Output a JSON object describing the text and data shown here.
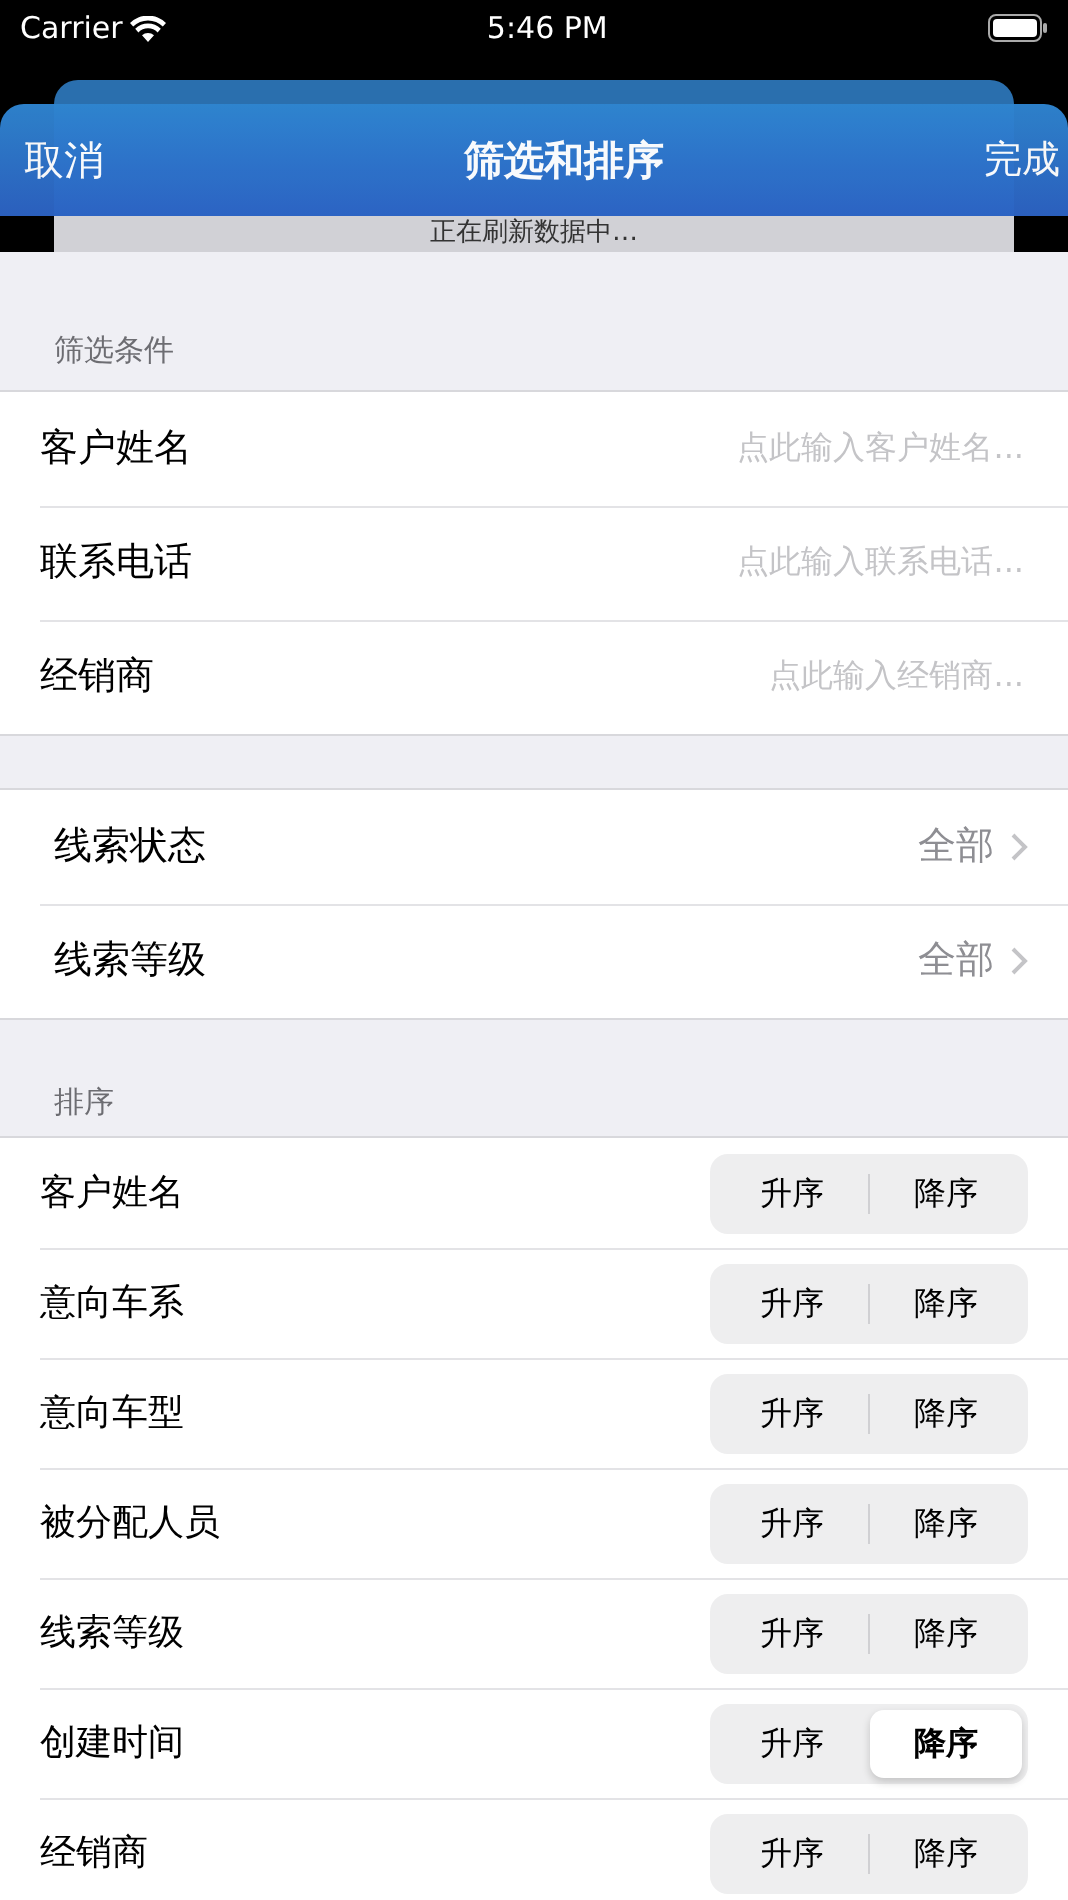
{
  "status_bar": {
    "carrier": "Carrier",
    "time": "5:46 PM"
  },
  "back_sheet": {
    "notice": "正在刷新数据中…"
  },
  "nav_bar": {
    "left": "取消",
    "title": "筛选和排序",
    "right": "完成"
  },
  "filter_section": {
    "header": "筛选条件",
    "fields": [
      {
        "label": "客户姓名",
        "placeholder": "点此输入客户姓名..."
      },
      {
        "label": "联系电话",
        "placeholder": "点此输入联系电话..."
      },
      {
        "label": "经销商",
        "placeholder": "点此输入经销商..."
      }
    ]
  },
  "pickers": [
    {
      "label": "线索状态",
      "value": "全部"
    },
    {
      "label": "线索等级",
      "value": "全部"
    }
  ],
  "sort_section": {
    "header": "排序",
    "rows": [
      {
        "label": "客户姓名",
        "options": [
          {
            "label": "升序",
            "selected": false
          },
          {
            "label": "降序",
            "selected": false
          }
        ]
      },
      {
        "label": "意向车系",
        "options": [
          {
            "label": "升序",
            "selected": false
          },
          {
            "label": "降序",
            "selected": false
          }
        ]
      },
      {
        "label": "意向车型",
        "options": [
          {
            "label": "升序",
            "selected": false
          },
          {
            "label": "降序",
            "selected": false
          }
        ]
      },
      {
        "label": "被分配人员",
        "options": [
          {
            "label": "升序",
            "selected": false
          },
          {
            "label": "降序",
            "selected": false
          }
        ]
      },
      {
        "label": "线索等级",
        "options": [
          {
            "label": "升序",
            "selected": false
          },
          {
            "label": "降序",
            "selected": false
          }
        ]
      },
      {
        "label": "创建时间",
        "options": [
          {
            "label": "升序",
            "selected": false
          },
          {
            "label": "降序",
            "selected": true
          }
        ]
      },
      {
        "label": "经销商",
        "options": [
          {
            "label": "升序",
            "selected": false
          },
          {
            "label": "降序",
            "selected": false
          }
        ]
      }
    ]
  }
}
